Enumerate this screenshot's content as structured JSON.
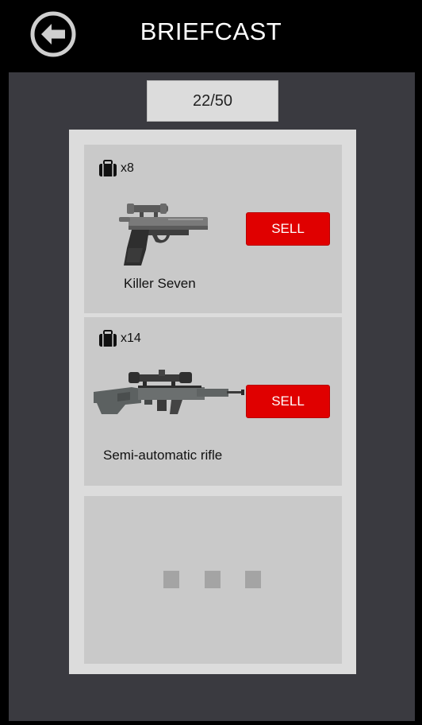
{
  "header": {
    "title": "BRIEFCAST",
    "back_icon": "back-arrow-icon"
  },
  "capacity": "22/50",
  "items": [
    {
      "quantity": "x8",
      "name": "Killer Seven",
      "sell_label": "SELL",
      "icon": "briefcase-icon"
    },
    {
      "quantity": "x14",
      "name": "Semi-automatic rifle",
      "sell_label": "SELL",
      "icon": "briefcase-icon"
    }
  ],
  "more_indicator_icon": "ellipsis-icon",
  "colors": {
    "background": "#000000",
    "panel": "#3a3a40",
    "list": "#dcdcdc",
    "card": "#c9c9c9",
    "sell_button": "#e00000"
  }
}
